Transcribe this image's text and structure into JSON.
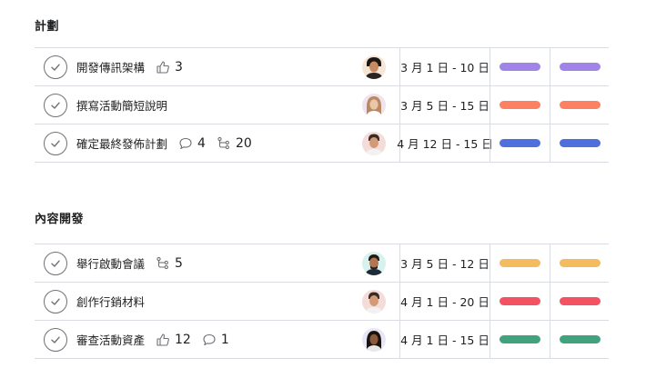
{
  "sections": [
    {
      "title": "計劃",
      "tasks": [
        {
          "name": "開發傳訊架構",
          "likes": "3",
          "comments": "",
          "subtasks": "",
          "date": "3 月 1 日 - 10 日",
          "color": "#a084e8"
        },
        {
          "name": "撰寫活動簡短說明",
          "likes": "",
          "comments": "",
          "subtasks": "",
          "date": "3 月 5 日 - 15 日",
          "color": "#fc8163"
        },
        {
          "name": "確定最終發佈計劃",
          "likes": "",
          "comments": "4",
          "subtasks": "20",
          "date": "4 月 12 日 - 15 日",
          "color": "#4e6fdc"
        }
      ]
    },
    {
      "title": "內容開發",
      "tasks": [
        {
          "name": "舉行啟動會議",
          "likes": "",
          "comments": "",
          "subtasks": "5",
          "date": "3 月 5 日 - 12 日",
          "color": "#f3bd5f"
        },
        {
          "name": "創作行銷材料",
          "likes": "",
          "comments": "",
          "subtasks": "",
          "date": "4 月 1 日 - 20 日",
          "color": "#f45263"
        },
        {
          "name": "審查活動資產",
          "likes": "12",
          "comments": "1",
          "subtasks": "",
          "date": "4 月 1 日 - 15 日",
          "color": "#3fa37e"
        }
      ]
    }
  ]
}
